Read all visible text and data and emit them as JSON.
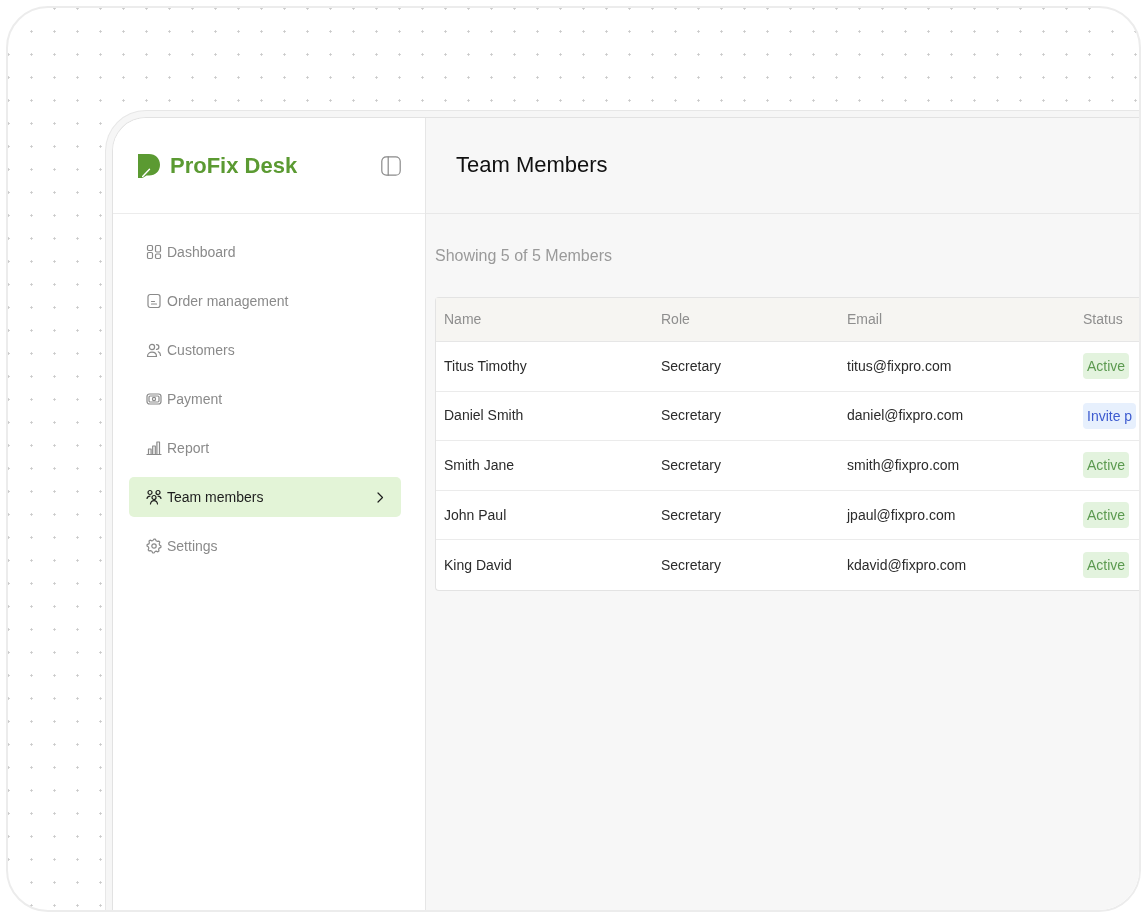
{
  "sidebar": {
    "brand": "ProFix Desk",
    "items": [
      {
        "label": "Dashboard",
        "selected": false
      },
      {
        "label": "Order management",
        "selected": false
      },
      {
        "label": "Customers",
        "selected": false
      },
      {
        "label": "Payment",
        "selected": false
      },
      {
        "label": "Report",
        "selected": false
      },
      {
        "label": "Team members",
        "selected": true
      },
      {
        "label": "Settings",
        "selected": false
      }
    ]
  },
  "header": {
    "title": "Team Members"
  },
  "summary": "Showing 5 of 5 Members",
  "table": {
    "columns": [
      "Name",
      "Role",
      "Email",
      "Status"
    ],
    "rows": [
      {
        "name": "Titus Timothy",
        "role": "Secretary",
        "email": "titus@fixpro.com",
        "status": {
          "text": "Active",
          "kind": "active"
        }
      },
      {
        "name": "Daniel Smith",
        "role": "Secretary",
        "email": "daniel@fixpro.com",
        "status": {
          "text": "Invite p",
          "kind": "invite"
        }
      },
      {
        "name": "Smith Jane",
        "role": "Secretary",
        "email": "smith@fixpro.com",
        "status": {
          "text": "Active",
          "kind": "active"
        }
      },
      {
        "name": "John Paul",
        "role": "Secretary",
        "email": "jpaul@fixpro.com",
        "status": {
          "text": "Active",
          "kind": "active"
        }
      },
      {
        "name": "King David",
        "role": "Secretary",
        "email": "kdavid@fixpro.com",
        "status": {
          "text": "Active",
          "kind": "active"
        }
      }
    ]
  }
}
